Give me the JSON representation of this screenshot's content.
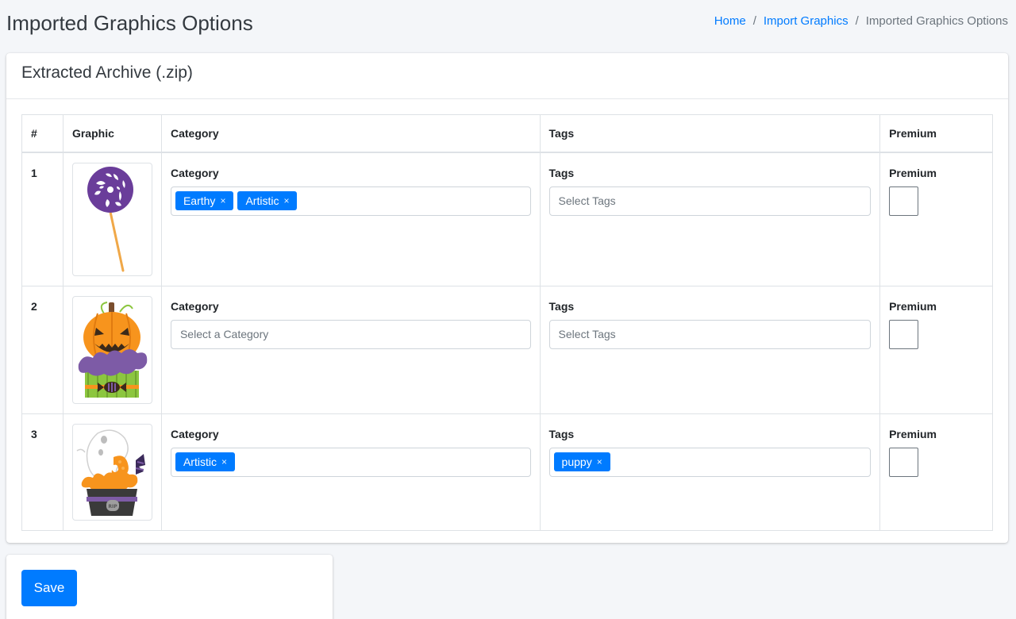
{
  "page": {
    "title": "Imported Graphics Options"
  },
  "breadcrumb": [
    {
      "label": "Home"
    },
    {
      "label": "Import Graphics"
    },
    {
      "label": "Imported Graphics Options"
    }
  ],
  "card": {
    "title": "Extracted Archive (.zip)"
  },
  "table": {
    "headers": {
      "num": "#",
      "graphic": "Graphic",
      "category": "Category",
      "tags": "Tags",
      "premium": "Premium"
    },
    "rows": [
      {
        "num": "1",
        "graphic_icon": "lollipop-icon",
        "category_label": "Category",
        "categories": [
          "Earthy",
          "Artistic"
        ],
        "category_placeholder": "",
        "tags_label": "Tags",
        "tags": [],
        "tags_placeholder": "Select Tags",
        "premium_label": "Premium"
      },
      {
        "num": "2",
        "graphic_icon": "pumpkin-cupcake-icon",
        "category_label": "Category",
        "categories": [],
        "category_placeholder": "Select a Category",
        "tags_label": "Tags",
        "tags": [],
        "tags_placeholder": "Select Tags",
        "premium_label": "Premium"
      },
      {
        "num": "3",
        "graphic_icon": "ghost-cupcake-icon",
        "category_label": "Category",
        "categories": [
          "Artistic"
        ],
        "category_placeholder": "",
        "tags_label": "Tags",
        "tags": [
          "puppy"
        ],
        "tags_placeholder": "",
        "premium_label": "Premium"
      }
    ]
  },
  "chip_remove": "×",
  "save_button": {
    "label": "Save"
  },
  "colors": {
    "primary": "#007bff",
    "background": "#f4f6f9"
  }
}
